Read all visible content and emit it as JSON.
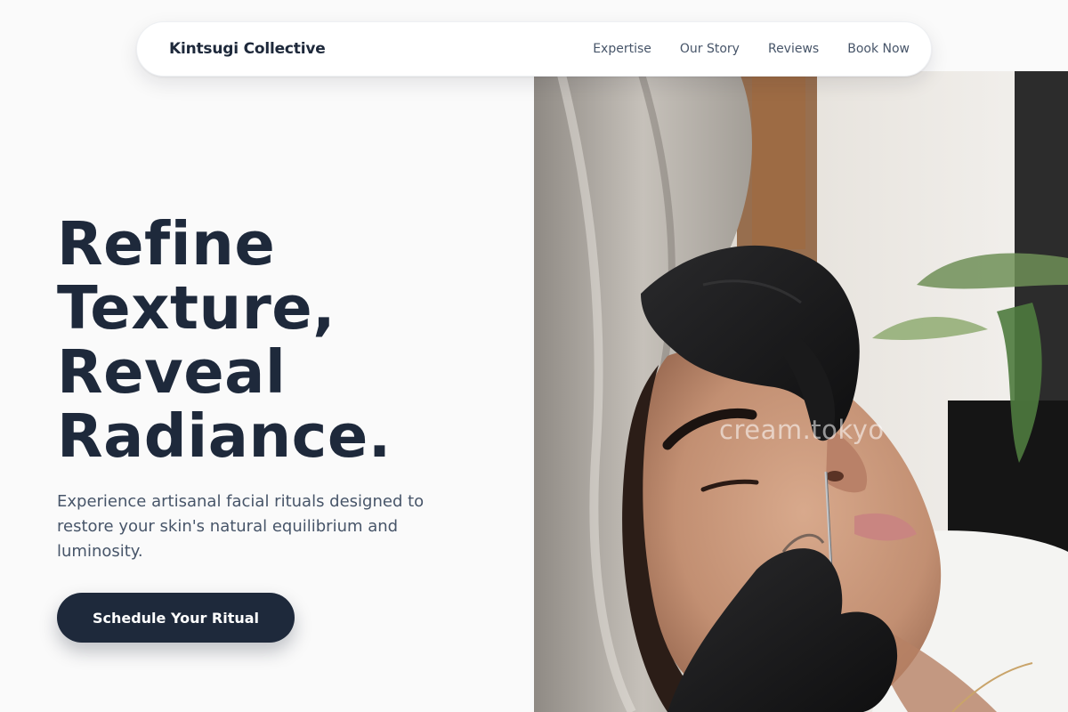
{
  "nav": {
    "brand": "Kintsugi Collective",
    "links": [
      "Expertise",
      "Our Story",
      "Reviews",
      "Book Now"
    ]
  },
  "hero": {
    "title_lines": [
      "Refine",
      "Texture,",
      "Reveal",
      "Radiance."
    ],
    "subtitle": "Experience artisanal facial rituals designed to restore your skin's natural equilibrium and luminosity.",
    "cta_label": "Schedule Your Ritual"
  },
  "photo": {
    "watermark": "cream.tokyo"
  },
  "colors": {
    "background": "#fafafa",
    "heading": "#1e293b",
    "body_text": "#475569",
    "cta_background": "#1e293b",
    "cta_text": "#ffffff"
  }
}
